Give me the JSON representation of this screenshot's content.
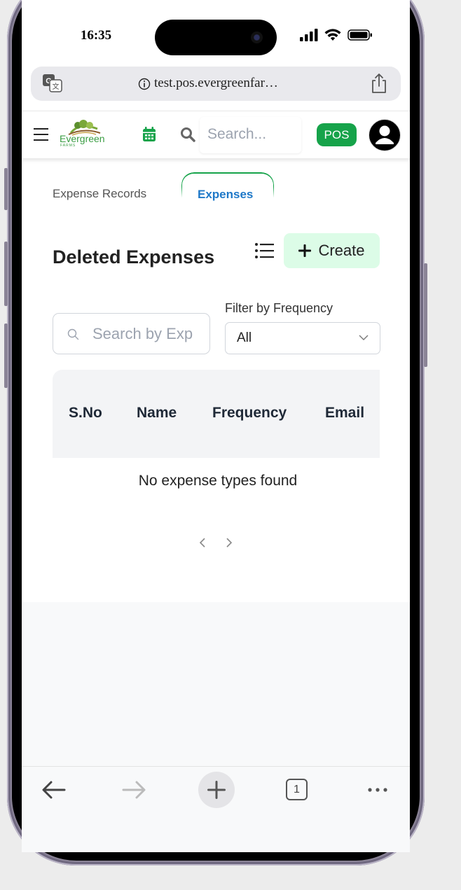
{
  "status_bar": {
    "time": "16:35"
  },
  "browser": {
    "url": "test.pos.evergreenfar…",
    "tab_count": "1"
  },
  "header": {
    "logo_text": "Evergreen",
    "logo_subtext": "FARMS",
    "search_placeholder": "Search...",
    "pos_badge": "POS"
  },
  "tabs": [
    {
      "label": "Expense Records",
      "active": false
    },
    {
      "label": "Expenses",
      "active": true
    }
  ],
  "page": {
    "title": "Deleted Expenses",
    "create_label": "Create",
    "search_placeholder": "Search by Exp",
    "filter_label": "Filter by Frequency",
    "filter_value": "All"
  },
  "table": {
    "columns": [
      "S.No",
      "Name",
      "Frequency",
      "Email"
    ],
    "empty_message": "No expense types found"
  },
  "colors": {
    "accent_green": "#16a34a",
    "create_bg": "#dcfce7",
    "active_tab_text": "#1e78c8"
  }
}
